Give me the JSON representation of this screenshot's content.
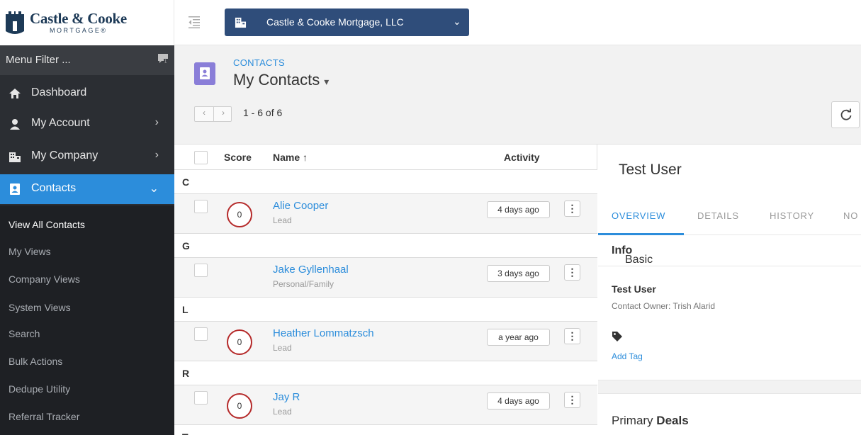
{
  "brand": {
    "name": "Castle & Cooke",
    "sub": "MORTGAGE",
    "registered": "®"
  },
  "sidebar": {
    "filter_placeholder": "Menu Filter ...",
    "items": [
      {
        "label": "Dashboard",
        "icon": "home-icon"
      },
      {
        "label": "My Account",
        "icon": "user-icon",
        "chevron": "›"
      },
      {
        "label": "My Company",
        "icon": "building-icon",
        "chevron": "›"
      },
      {
        "label": "Contacts",
        "icon": "contacts-icon",
        "chevron": "⌄"
      }
    ],
    "subitems": [
      "View All Contacts",
      "My Views",
      "Company Views",
      "System Views",
      "Search",
      "Bulk Actions",
      "Dedupe Utility",
      "Referral Tracker"
    ]
  },
  "topbar": {
    "company": "Castle & Cooke Mortgage, LLC",
    "company_chevron": "⌄"
  },
  "header": {
    "breadcrumb": "CONTACTS",
    "title": "My Contacts",
    "title_caret": "▾",
    "pager_prev": "‹",
    "pager_next": "›",
    "count": "1 - 6 of 6"
  },
  "list": {
    "columns": {
      "score": "Score",
      "name": "Name ↑",
      "activity": "Activity"
    },
    "groups": [
      {
        "letter": "C",
        "contacts": [
          {
            "name": "Alie Cooper",
            "type": "Lead",
            "score": "0",
            "activity": "4 days ago"
          }
        ]
      },
      {
        "letter": "G",
        "contacts": [
          {
            "name": "Jake Gyllenhaal",
            "type": "Personal/Family",
            "score": "",
            "activity": "3 days ago"
          }
        ]
      },
      {
        "letter": "L",
        "contacts": [
          {
            "name": "Heather Lommatzsch",
            "type": "Lead",
            "score": "0",
            "activity": "a year ago"
          }
        ]
      },
      {
        "letter": "R",
        "contacts": [
          {
            "name": "Jay R",
            "type": "Lead",
            "score": "0",
            "activity": "4 days ago"
          }
        ]
      },
      {
        "letter": "T"
      }
    ],
    "kebab": "⋮"
  },
  "detail": {
    "title": "Test User",
    "tabs": [
      "OVERVIEW",
      "DETAILS",
      "HISTORY",
      "NO"
    ],
    "basic_info": {
      "prefix": "Basic",
      "bold": "Info"
    },
    "contact_name": "Test User",
    "owner": "Contact Owner: Trish Alarid",
    "add_tag": "Add Tag",
    "primary_deals": {
      "prefix": "Primary",
      "bold": "Deals"
    }
  }
}
